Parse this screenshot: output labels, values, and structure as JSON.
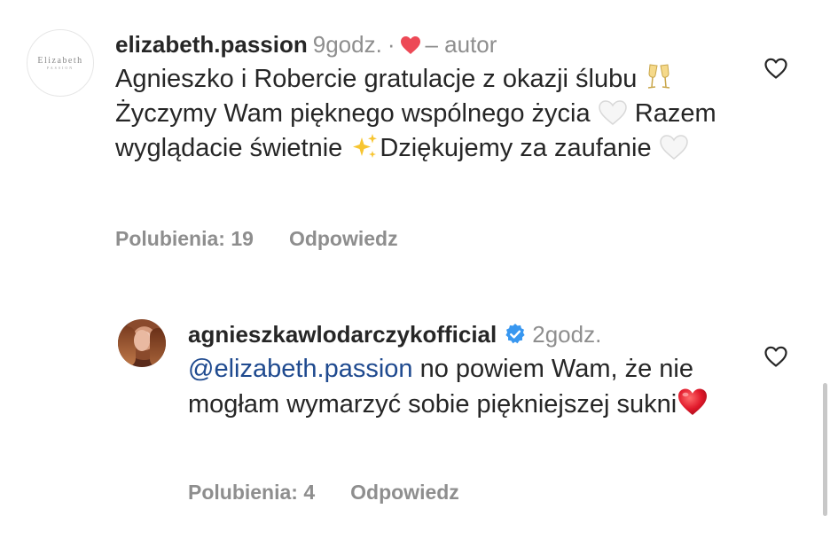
{
  "comments": [
    {
      "username": "elizabeth.passion",
      "time": "9godz.",
      "separator": "·",
      "author_label": "– autor",
      "avatar_brand": "Elizabeth",
      "avatar_brand_sub": "PASSION",
      "text_parts": [
        "Agnieszko i Robercie gratulacje z okazji ślubu ",
        " Życzymy Wam pięknego wspólnego życia ",
        " Razem wyglądacie świetnie ",
        "Dziękujemy za zaufanie "
      ],
      "likes": "Polubienia: 19",
      "reply": "Odpowiedz"
    },
    {
      "username": "agnieszkawlodarczykofficial",
      "time": "2godz.",
      "mention": "@elizabeth.passion",
      "text": " no powiem Wam, że nie mogłam wymarzyć sobie piękniejszej sukni",
      "likes": "Polubienia: 4",
      "reply": "Odpowiedz"
    }
  ],
  "colors": {
    "text": "#262626",
    "secondary": "#8e8e8e",
    "mention": "#1f4a8f",
    "heart": "#ed4956",
    "verified": "#3897f0"
  },
  "icons": [
    "red-heart-icon",
    "champagne-emoji",
    "white-heart-emoji",
    "sparkles-emoji",
    "verified-badge-icon",
    "like-heart-icon"
  ]
}
